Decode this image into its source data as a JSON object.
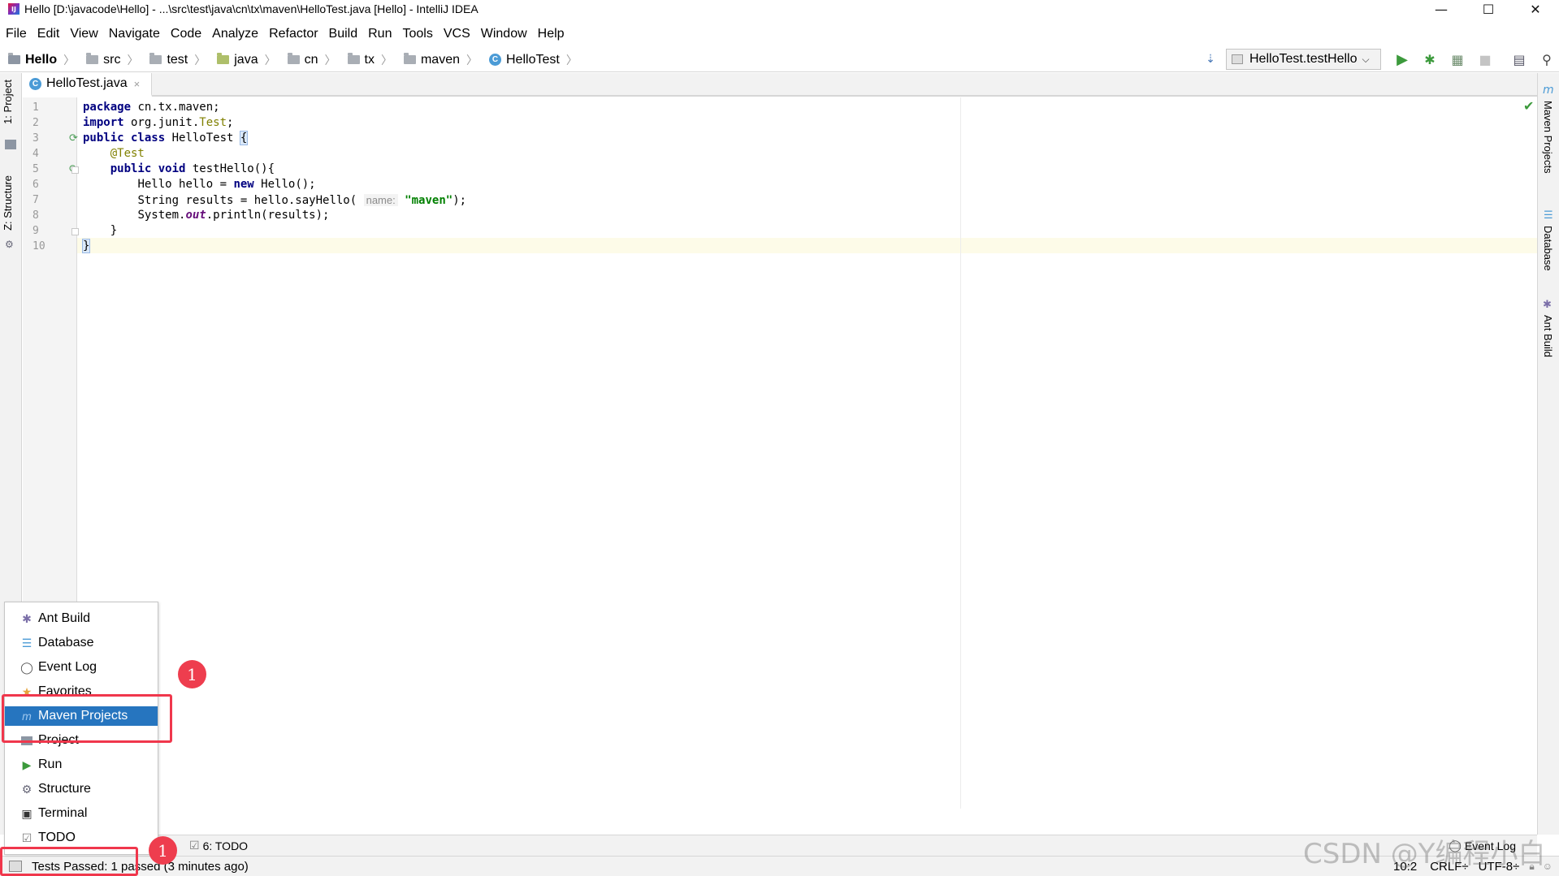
{
  "window": {
    "title": "Hello [D:\\javacode\\Hello] - ...\\src\\test\\java\\cn\\tx\\maven\\HelloTest.java [Hello] - IntelliJ IDEA",
    "minimize": "—",
    "maximize": "☐",
    "close": "✕"
  },
  "menu": [
    "File",
    "Edit",
    "View",
    "Navigate",
    "Code",
    "Analyze",
    "Refactor",
    "Build",
    "Run",
    "Tools",
    "VCS",
    "Window",
    "Help"
  ],
  "breadcrumb": [
    "Hello",
    "src",
    "test",
    "java",
    "cn",
    "tx",
    "maven",
    "HelloTest"
  ],
  "run_config": "HelloTest.testHello",
  "left_tabs": [
    "1: Project",
    "Z: Structure"
  ],
  "right_tabs": [
    "Maven Projects",
    "Database",
    "Ant Build"
  ],
  "editor_tab": {
    "label": "HelloTest.java",
    "close": "×"
  },
  "code": {
    "line_numbers": [
      "1",
      "2",
      "3",
      "4",
      "5",
      "6",
      "7",
      "8",
      "9",
      "10"
    ],
    "l1_kw": "package",
    "l1_rest": " cn.tx.maven;",
    "l2_kw": "import",
    "l2_pre": " org.junit.",
    "l2_an": "Test",
    "l2_post": ";",
    "l3_kw": "public class",
    "l3_rest": " HelloTest ",
    "l3_brace": "{",
    "l4_an": "@Test",
    "l5_kw": "public void",
    "l5_rest": " testHello(){",
    "l6_pre": "Hello hello = ",
    "l6_kw": "new",
    "l6_post": " Hello();",
    "l7_pre": "String results = hello.sayHello(",
    "l7_hint": "name:",
    "l7_str": "\"maven\"",
    "l7_post": ");",
    "l8_pre": "System.",
    "l8_it": "out",
    "l8_post": ".println(results);",
    "l9": "}",
    "l10": "}"
  },
  "popup": {
    "items": [
      {
        "label": "Ant Build",
        "icon": "ant-icon"
      },
      {
        "label": "Database",
        "icon": "database-icon"
      },
      {
        "label": "Event Log",
        "icon": "event-log-icon"
      },
      {
        "label": "Favorites",
        "icon": "star-icon"
      },
      {
        "label": "Maven Projects",
        "icon": "maven-icon"
      },
      {
        "label": "Project",
        "icon": "folder-icon"
      },
      {
        "label": "Run",
        "icon": "play-icon"
      },
      {
        "label": "Structure",
        "icon": "structure-icon"
      },
      {
        "label": "Terminal",
        "icon": "terminal-icon"
      },
      {
        "label": "TODO",
        "icon": "todo-icon"
      }
    ],
    "selected_index": 4
  },
  "bottom_tabs": {
    "todo": "6: TODO",
    "event_log": "Event Log"
  },
  "status": {
    "message": "Tests Passed: 1 passed (3 minutes ago)",
    "position": "10:2",
    "line_sep": "CRLF÷",
    "encoding": "UTF-8÷"
  },
  "annotations": {
    "badge1": "1",
    "badge2": "1"
  },
  "watermark": "CSDN @Y编程小白",
  "colors": {
    "selection": "#2675bf",
    "annotation_red": "#f0374c",
    "run_green": "#3c9a3c"
  }
}
